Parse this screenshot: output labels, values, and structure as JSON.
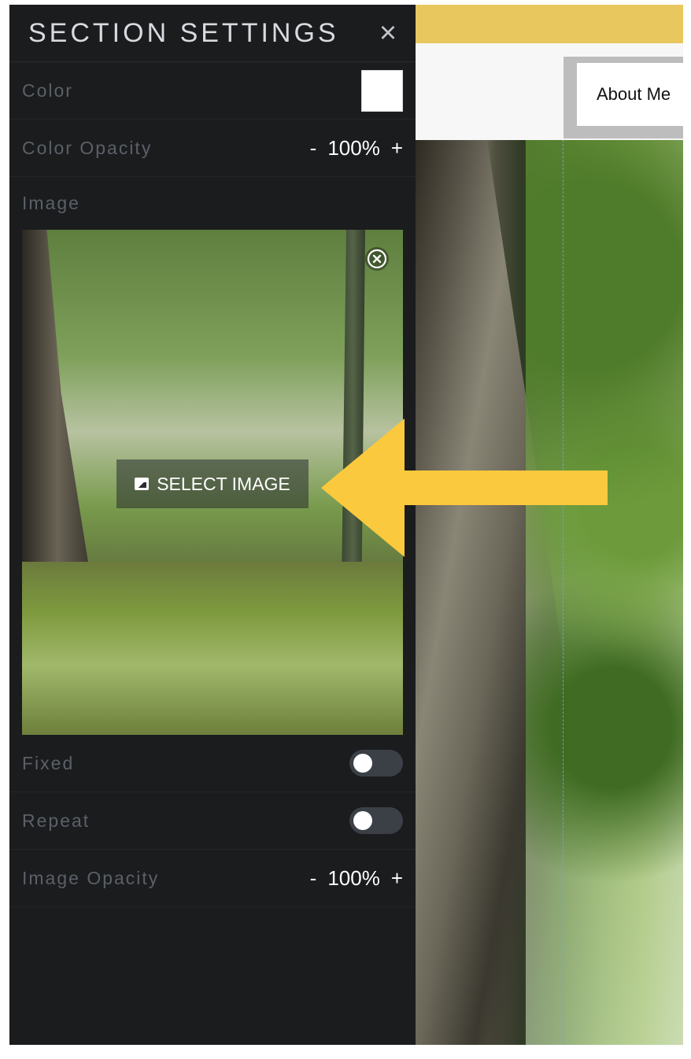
{
  "panel": {
    "title": "SECTION SETTINGS",
    "close_icon": "close-icon",
    "rows": {
      "color_label": "Color",
      "color_opacity_label": "Color Opacity",
      "color_opacity_minus": "-",
      "color_opacity_value": "100%",
      "color_opacity_plus": "+",
      "image_label": "Image",
      "select_image_label": "SELECT IMAGE",
      "fixed_label": "Fixed",
      "repeat_label": "Repeat",
      "image_opacity_label": "Image Opacity",
      "image_opacity_minus": "-",
      "image_opacity_value": "100%",
      "image_opacity_plus": "+"
    },
    "toggles": {
      "fixed_on": false,
      "repeat_on": false
    }
  },
  "site": {
    "nav_item": "About Me"
  },
  "colors": {
    "panel_bg": "#1b1c1e",
    "label_gray": "#5b6068",
    "arrow_yellow": "#fbc93d",
    "topbar_yellow": "#e8c75f"
  },
  "icons": {
    "remove_image": "remove-circle-icon",
    "select_image": "image-icon"
  }
}
